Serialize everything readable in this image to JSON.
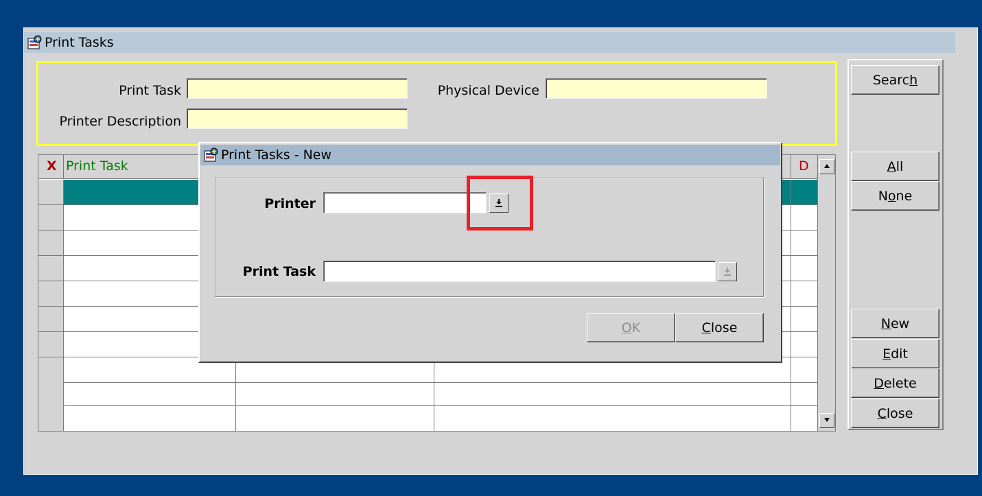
{
  "main_window": {
    "title": "Print Tasks"
  },
  "search": {
    "print_task_label": "Print Task",
    "physical_device_label": "Physical Device",
    "printer_description_label": "Printer Description",
    "print_task_value": "",
    "physical_device_value": "",
    "printer_description_value": ""
  },
  "grid": {
    "columns": {
      "select": "X",
      "print_task": "Print Task",
      "d": "D"
    }
  },
  "buttons": {
    "search": {
      "pre": "Searc",
      "key": "h",
      "post": ""
    },
    "all": {
      "pre": "",
      "key": "A",
      "post": "ll"
    },
    "none": {
      "pre": "N",
      "key": "o",
      "post": "ne"
    },
    "new": {
      "pre": "",
      "key": "N",
      "post": "ew"
    },
    "edit": {
      "pre": "",
      "key": "E",
      "post": "dit"
    },
    "delete": {
      "pre": "",
      "key": "D",
      "post": "elete"
    },
    "close": {
      "pre": "",
      "key": "C",
      "post": "lose"
    }
  },
  "dialog": {
    "title": "Print Tasks - New",
    "printer_label": "Printer",
    "printer_value": "",
    "print_task_label": "Print Task",
    "print_task_value": "",
    "ok": {
      "pre": "",
      "key": "O",
      "post": "K"
    },
    "close": {
      "pre": "",
      "key": "C",
      "post": "lose"
    }
  },
  "colors": {
    "highlight": "#e8202a",
    "selected_row": "#008080",
    "search_border": "#ffff33",
    "desktop": "#003f80"
  }
}
